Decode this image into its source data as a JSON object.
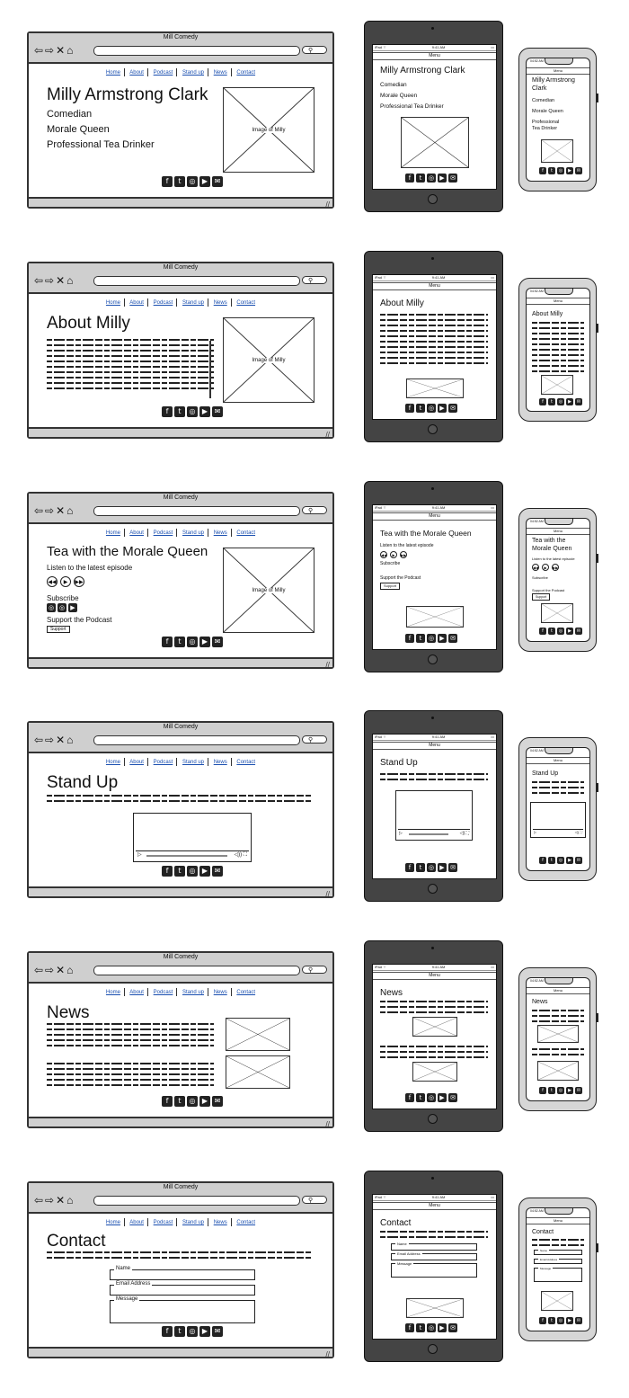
{
  "browser": {
    "title": "Mill Comedy",
    "nav_icons": "⇦⇨✕⌂",
    "search_icon": "⚲"
  },
  "nav_links": [
    "Home",
    "About",
    "Podcast",
    "Stand up",
    "News",
    "Contact"
  ],
  "social_icons": [
    "f",
    "t",
    "◎",
    "▶",
    "✉"
  ],
  "menu_label": "Menu",
  "image_caption": "Image of Milly",
  "status": {
    "left": "iPad ⌔",
    "time": "9:41 AM",
    "right": "▭",
    "phone_time": "04:52 AM"
  },
  "home": {
    "title": "Milly Armstrong Clark",
    "lines": [
      "Comedian",
      "Morale Queen",
      "Professional Tea Drinker"
    ],
    "phone_title": [
      "Milly Armstrong",
      "Clark"
    ],
    "phone_tea": [
      "Professional",
      "Tea Drinker"
    ]
  },
  "about": {
    "title": "About Milly"
  },
  "podcast": {
    "title": "Tea with the Morale Queen",
    "phone_title": [
      "Tea with the",
      "Morale Queen"
    ],
    "listen": "Listen to the latest episode",
    "subscribe": "Subscribe",
    "support": "Support the Podcast",
    "support_button": "Support",
    "controls": [
      "◀◀",
      "▶",
      "▶▶"
    ]
  },
  "standup": {
    "title": "Stand Up",
    "video_controls": "▷  ◁)) ⛶"
  },
  "news": {
    "title": "News"
  },
  "contact": {
    "title": "Contact",
    "fields": [
      "Name",
      "Email Address",
      "Message"
    ]
  }
}
